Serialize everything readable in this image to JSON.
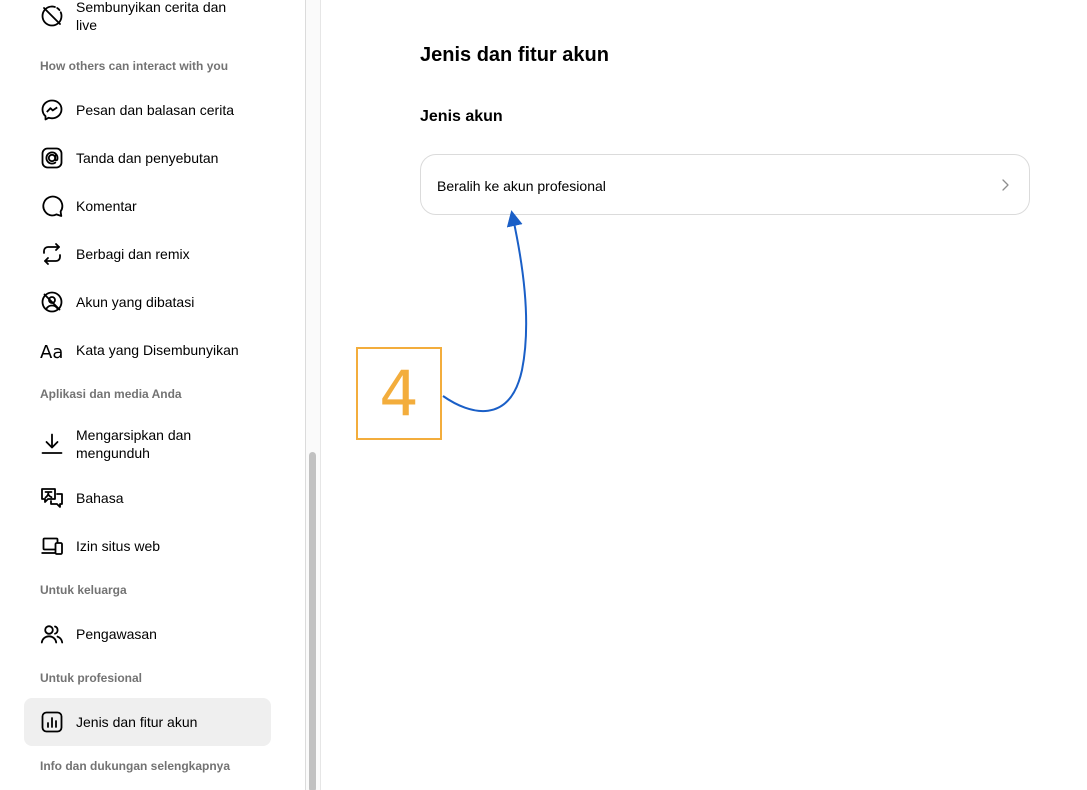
{
  "sidebar": {
    "top_item": {
      "label": "Sembunyikan cerita dan live",
      "icon": "hide-story-icon"
    },
    "sections": {
      "interact": "How others can interact with you",
      "apps": "Aplikasi dan media Anda",
      "family": "Untuk keluarga",
      "professional": "Untuk profesional",
      "more": "Info dan dukungan selengkapnya"
    },
    "items": [
      {
        "label": "Pesan dan balasan cerita",
        "icon": "messenger-icon"
      },
      {
        "label": "Tanda dan penyebutan",
        "icon": "at-sign-icon"
      },
      {
        "label": "Komentar",
        "icon": "comment-icon"
      },
      {
        "label": "Berbagi dan remix",
        "icon": "share-remix-icon"
      },
      {
        "label": "Akun yang dibatasi",
        "icon": "restricted-account-icon"
      },
      {
        "label": "Kata yang Disembunyikan",
        "icon": "hidden-words-icon"
      },
      {
        "label": "Mengarsipkan dan mengunduh",
        "icon": "download-icon"
      },
      {
        "label": "Bahasa",
        "icon": "language-icon"
      },
      {
        "label": "Izin situs web",
        "icon": "devices-icon"
      },
      {
        "label": "Pengawasan",
        "icon": "supervision-icon"
      },
      {
        "label": "Jenis dan fitur akun",
        "icon": "account-type-icon"
      }
    ]
  },
  "main": {
    "title": "Jenis dan fitur akun",
    "subtitle": "Jenis akun",
    "card_label": "Beralih ke akun profesional"
  },
  "annotation": {
    "step": "4",
    "color": "#f3ad3c",
    "arrow_color": "#1a5fc7"
  },
  "colors": {
    "active_bg": "#efefef",
    "section_text": "#737373",
    "border": "#dbdbdb"
  }
}
